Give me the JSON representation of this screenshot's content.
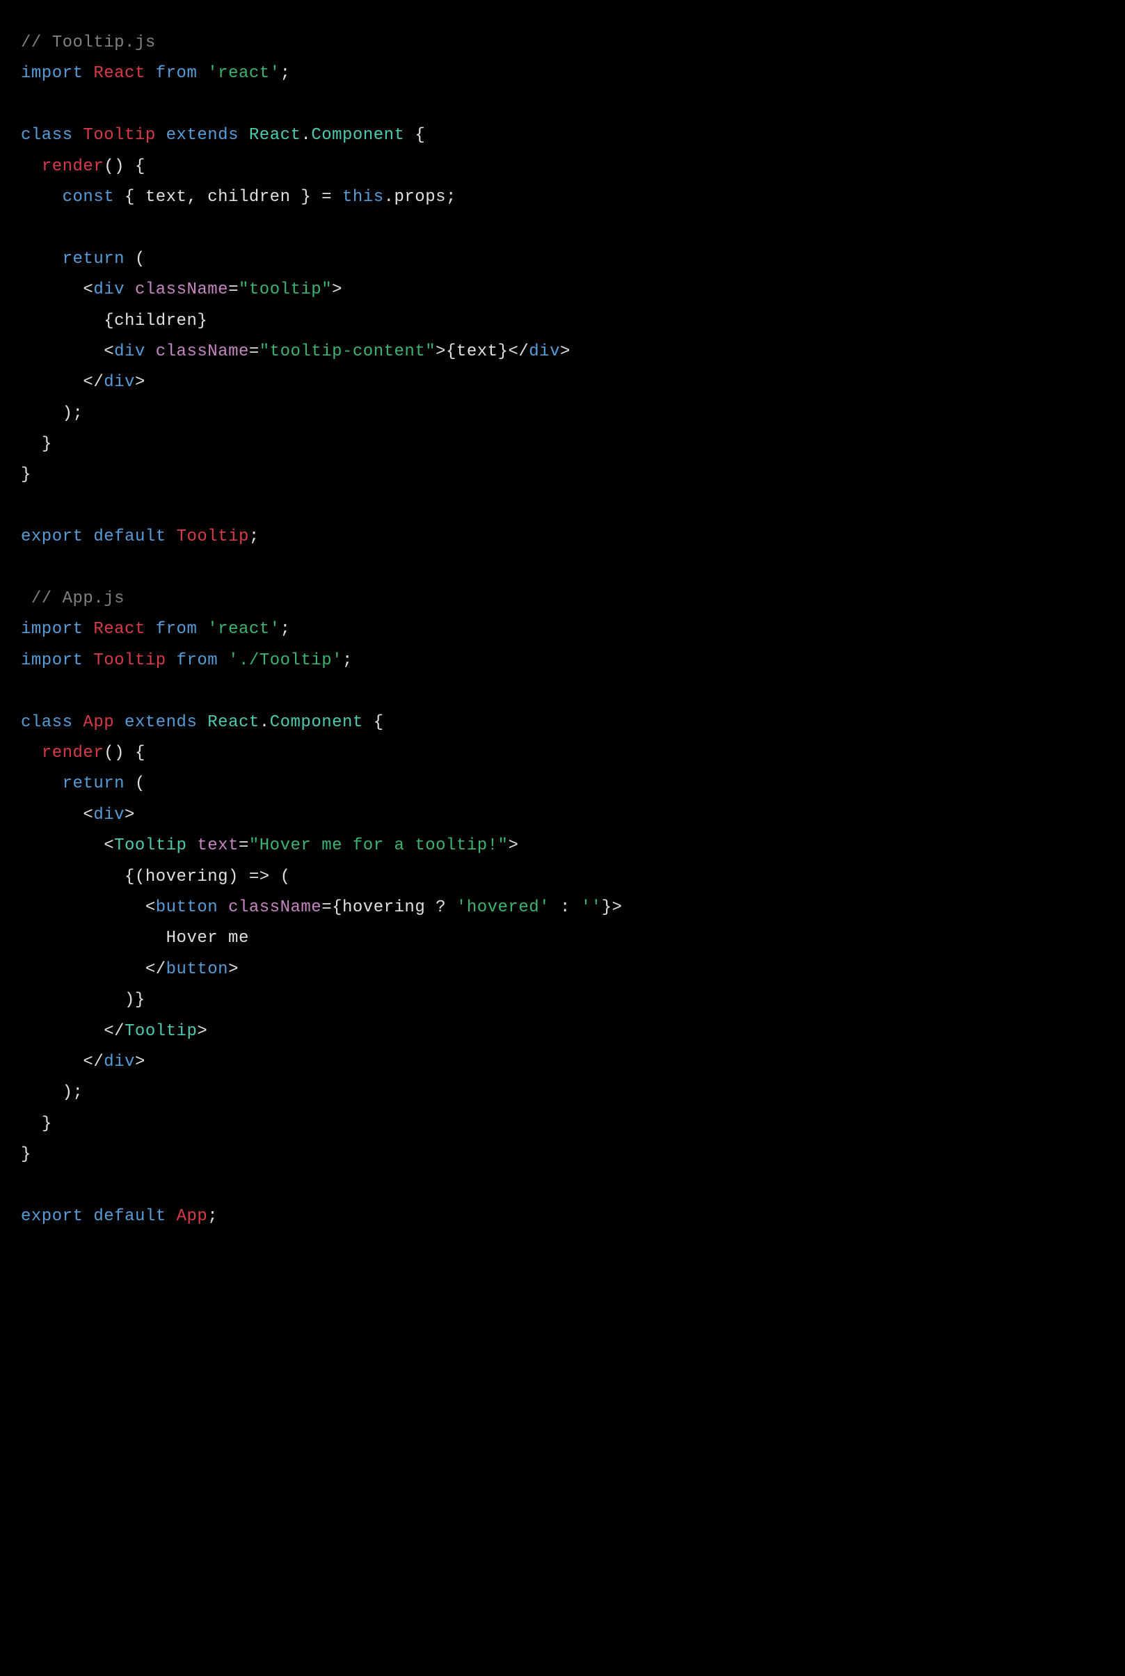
{
  "lines": {
    "l1_comment": "// Tooltip.js",
    "l2_import": "import",
    "l2_react": "React",
    "l2_from": "from",
    "l2_str": "'react'",
    "l2_semi": ";",
    "l4_class": "class",
    "l4_name": "Tooltip",
    "l4_extends": "extends",
    "l4_reactns": "React",
    "l4_dot": ".",
    "l4_comp": "Component",
    "l4_brace": " {",
    "l5_render": "render",
    "l5_parens": "() {",
    "l6_const": "const",
    "l6_destr": " { text, children } = ",
    "l6_this": "this",
    "l6_props": ".props;",
    "l8_return": "return",
    "l8_paren": " (",
    "l9_open": "<",
    "l9_div": "div",
    "l9_sp": " ",
    "l9_cn": "className",
    "l9_eq": "=",
    "l9_str": "\"tooltip\"",
    "l9_close": ">",
    "l10_children": "{children}",
    "l11_open": "<",
    "l11_div": "div",
    "l11_sp": " ",
    "l11_cn": "className",
    "l11_eq": "=",
    "l11_str": "\"tooltip-content\"",
    "l11_close": ">",
    "l11_text": "{text}",
    "l11_closediv": "</",
    "l11_div2": "div",
    "l11_close2": ">",
    "l12_closediv": "</",
    "l12_div": "div",
    "l12_close": ">",
    "l13_close": ");",
    "l14_brace": "}",
    "l15_brace": "}",
    "l17_export": "export",
    "l17_default": "default",
    "l17_name": "Tooltip",
    "l17_semi": ";",
    "l19_comment": " // App.js",
    "l20_import": "import",
    "l20_react": "React",
    "l20_from": "from",
    "l20_str": "'react'",
    "l20_semi": ";",
    "l21_import": "import",
    "l21_tooltip": "Tooltip",
    "l21_from": "from",
    "l21_str": "'./Tooltip'",
    "l21_semi": ";",
    "l23_class": "class",
    "l23_name": "App",
    "l23_extends": "extends",
    "l23_reactns": "React",
    "l23_dot": ".",
    "l23_comp": "Component",
    "l23_brace": " {",
    "l24_render": "render",
    "l24_parens": "() {",
    "l25_return": "return",
    "l25_paren": " (",
    "l26_open": "<",
    "l26_div": "div",
    "l26_close": ">",
    "l27_open": "<",
    "l27_tooltip": "Tooltip",
    "l27_sp": " ",
    "l27_text": "text",
    "l27_eq": "=",
    "l27_str": "\"Hover me for a tooltip!\"",
    "l27_close": ">",
    "l28_fn": "{(hovering) => (",
    "l29_open": "<",
    "l29_button": "button",
    "l29_sp": " ",
    "l29_cn": "className",
    "l29_eq": "=",
    "l29_brace": "{hovering ? ",
    "l29_str1": "'hovered'",
    "l29_colon": " : ",
    "l29_str2": "''",
    "l29_brace2": "}",
    "l29_close": ">",
    "l30_text": "Hover me",
    "l31_closebtn": "</",
    "l31_button": "button",
    "l31_close": ">",
    "l32_close": ")}",
    "l33_closetool": "</",
    "l33_tooltip": "Tooltip",
    "l33_close": ">",
    "l34_closediv": "</",
    "l34_div": "div",
    "l34_close": ">",
    "l35_close": ");",
    "l36_brace": "}",
    "l37_brace": "}",
    "l39_export": "export",
    "l39_default": "default",
    "l39_name": "App",
    "l39_semi": ";"
  }
}
